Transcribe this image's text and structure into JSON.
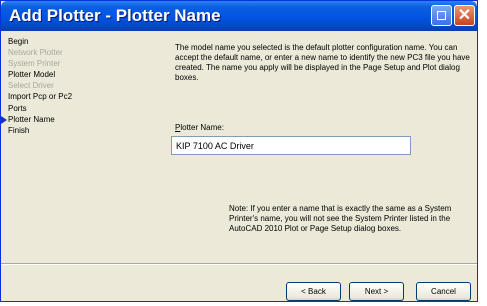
{
  "window": {
    "title": "Add Plotter - Plotter Name"
  },
  "steps": [
    {
      "label": "Begin",
      "state": "normal"
    },
    {
      "label": "Network Plotter",
      "state": "disabled"
    },
    {
      "label": "System Printer",
      "state": "disabled"
    },
    {
      "label": "Plotter Model",
      "state": "normal"
    },
    {
      "label": "Select Driver",
      "state": "disabled"
    },
    {
      "label": "Import Pcp or Pc2",
      "state": "normal"
    },
    {
      "label": "Ports",
      "state": "normal"
    },
    {
      "label": "Plotter Name",
      "state": "current"
    },
    {
      "label": "Finish",
      "state": "normal"
    }
  ],
  "content": {
    "description": "The model name you selected is the default plotter configuration name. You can accept the default name, or enter a new name to identify the new PC3 file you have created. The name you apply will be displayed in the Page Setup and Plot dialog boxes.",
    "field_label_accel": "P",
    "field_label_rest": "lotter Name:",
    "plotter_name_value": "KIP 7100 AC Driver",
    "note": "Note: If you enter a name that is exactly the same as a System Printer's name, you will not see the System Printer listed in the AutoCAD 2010 Plot or Page Setup dialog boxes."
  },
  "buttons": {
    "back": "< Back",
    "next": "Next >",
    "cancel": "Cancel"
  },
  "colors": {
    "titlebar": "#0154e3",
    "dialog_bg": "#ece9d8",
    "disabled_text": "#a8a8a0",
    "step_arrow": "#1a2fbf"
  },
  "icons": {
    "help": "help-icon",
    "close": "close-icon",
    "current_step": "arrow-right-icon"
  }
}
